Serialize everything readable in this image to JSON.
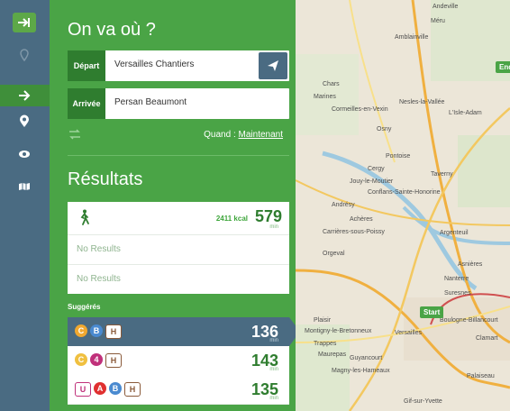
{
  "sidebar": {
    "icons": [
      "arrow-in-icon",
      "map-pin-icon",
      "arrow-right-icon",
      "location-pin-icon",
      "eye-icon",
      "map-icon"
    ]
  },
  "planner": {
    "title": "On va où ?",
    "departure": {
      "tag": "Départ",
      "value": "Versailles Chantiers"
    },
    "arrival": {
      "tag": "Arrivée",
      "value": "Persan Beaumont"
    },
    "when_label": "Quand :",
    "when_value": "Maintenant"
  },
  "results": {
    "title": "Résultats",
    "walk": {
      "kcal": "2411 kcal",
      "minutes": "579",
      "unit": "min"
    },
    "no_results": [
      "No Results",
      "No Results"
    ],
    "suggestions_label": "Suggérés",
    "suggestions": [
      {
        "minutes": "136",
        "unit": "min",
        "lines": [
          {
            "t": "C",
            "bg": "#f0a830",
            "shape": "circ"
          },
          {
            "t": "B",
            "bg": "#4a8ad0",
            "shape": "circ"
          },
          {
            "t": "H",
            "bg": "#8a5a3a",
            "shape": "sq"
          }
        ]
      },
      {
        "minutes": "143",
        "unit": "min",
        "lines": [
          {
            "t": "C",
            "bg": "#f0c040",
            "shape": "circ"
          },
          {
            "t": "4",
            "bg": "#c0307a",
            "shape": "circ"
          },
          {
            "t": "H",
            "bg": "#8a5a3a",
            "shape": "sq"
          }
        ]
      },
      {
        "minutes": "135",
        "unit": "min",
        "lines": [
          {
            "t": "U",
            "bg": "#c0307a",
            "shape": "sq"
          },
          {
            "t": "A",
            "bg": "#e03030",
            "shape": "circ"
          },
          {
            "t": "B",
            "bg": "#4a8ad0",
            "shape": "circ"
          },
          {
            "t": "H",
            "bg": "#8a5a3a",
            "shape": "sq"
          }
        ]
      }
    ]
  },
  "map": {
    "labels": [
      "Andeville",
      "Méru",
      "Amblainville",
      "Chars",
      "Marines",
      "Nesles-la-Vallée",
      "Cormeilles-en-Vexin",
      "L'Isle-Adam",
      "Osny",
      "Pontoise",
      "Cergy",
      "Jouy-le-Moutier",
      "Conflans-Sainte-Honorine",
      "Taverny",
      "Andrésy",
      "Achères",
      "Carrières-sous-Poissy",
      "Argenteuil",
      "Orgeval",
      "Asnières",
      "Nanterre",
      "Suresnes",
      "Boulogne-Billancourt",
      "Plaisir",
      "Montigny-le-Bretonneux",
      "Trappes",
      "Versailles",
      "Maurepas",
      "Guyancourt",
      "Magny-les-Hameaux",
      "Clamart",
      "Palaiseau",
      "Gif-sur-Yvette"
    ],
    "start_pin": "Start",
    "end_pin": "End"
  },
  "colors": {
    "green": "#4aa446",
    "dark_green": "#2f7d2f",
    "slate": "#4a6b82"
  }
}
